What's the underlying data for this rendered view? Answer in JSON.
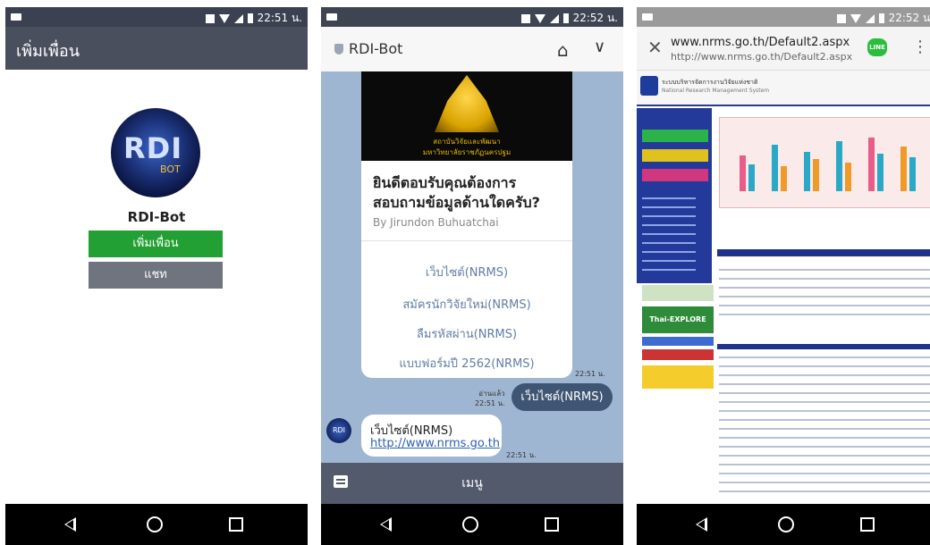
{
  "status_bar": {
    "time_1": "22:51 น.",
    "time_2": "22:52 น.",
    "time_3": "22:52 น."
  },
  "phone1": {
    "header_title": "เพิ่มเพื่อน",
    "avatar": {
      "text_main": "RDI",
      "text_sub": "BOT"
    },
    "bot_name": "RDI-Bot",
    "add_friend_label": "เพิ่มเพื่อน",
    "chat_label": "แชท"
  },
  "phone2": {
    "header_title": "RDI-Bot",
    "card": {
      "image_line1": "สถาบันวิจัยและพัฒนา",
      "image_line2": "มหาวิทยาลัยราชภัฏนครปฐม",
      "question": "ยินดีตอบรับคุณต้องการสอบถามข้อมูลด้านใดครับ?",
      "author": "By Jirundon Buhuatchai",
      "links": [
        "เว็บไซต์(NRMS)",
        "สมัครนักวิจัยใหม่(NRMS)",
        "ลืมรหัสผ่าน(NRMS)",
        "แบบฟอร์มปี 2562(NRMS)"
      ]
    },
    "card_time": "22:51 น.",
    "read_label": "อ่านแล้ว",
    "user_msg_time": "22:51 น.",
    "user_msg": "เว็บไซต์(NRMS)",
    "bot_avatar_text": "RDI",
    "bot_reply_line1": "เว็บไซต์(NRMS)",
    "bot_reply_link": "http://www.nrms.go.th",
    "bot_reply_time": "22:51 น.",
    "menu_label": "เมนู"
  },
  "phone3": {
    "url_title": "www.nrms.go.th/Default2.aspx",
    "url_full": "http://www.nrms.go.th/Default2.aspx",
    "line_badge": "LINE",
    "site_title": "ระบบบริหารจัดการงานวิจัยแห่งชาติ",
    "site_subtitle": "National Research Management System",
    "banner_label": "Thai-EXPLORE"
  },
  "colors": {
    "add_green": "#23a034",
    "chat_gray": "#70747f",
    "chat_bg": "#9fb6d3",
    "user_bubble": "#3e5573",
    "link_blue": "#5f7ea6"
  }
}
